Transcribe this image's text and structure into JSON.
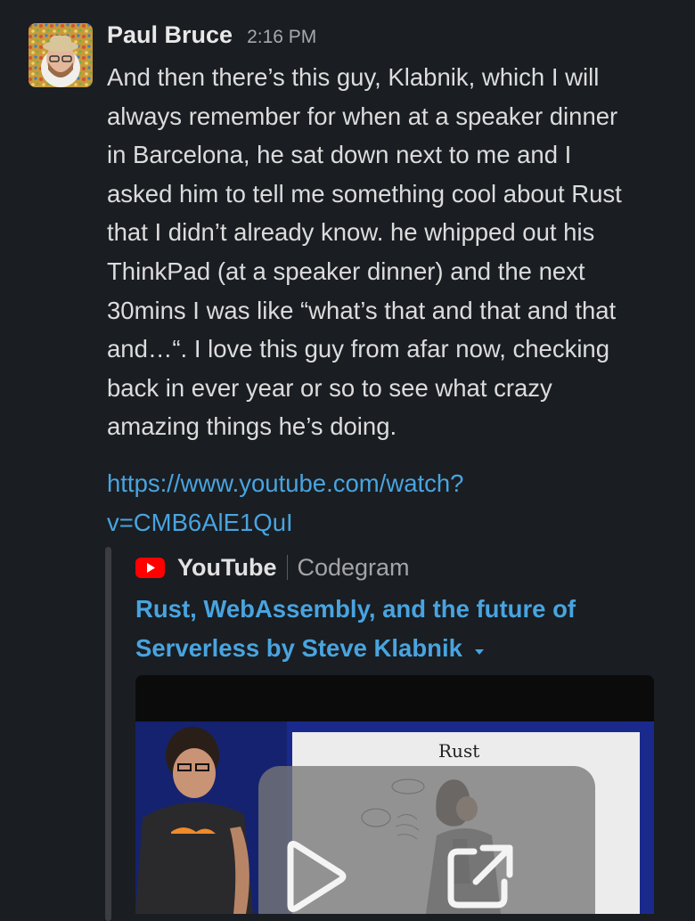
{
  "message": {
    "author": "Paul Bruce",
    "timestamp": "2:16 PM",
    "body": "And then there’s this guy, Klabnik, which I will\nalways remember for when at a speaker dinner\nin Barcelona, he sat down next to me and I\nasked him to tell me something cool about Rust\nthat I didn’t already know. he whipped out his\nThinkPad (at a speaker dinner) and the next\n30mins I was like “what’s that and that and that\nand…“. I love this guy from afar now, checking\nback in ever year or so to see what crazy\namazing things he’s doing.",
    "link_text": "https://www.youtube.com/watch?\nv=CMB6AlE1QuI"
  },
  "unfurl": {
    "service": "YouTube",
    "channel": "Codegram",
    "title": "Rust, WebAssembly, and the future of\nServerless by Steve Klabnik",
    "thumbnail_slide_text": "Rust",
    "icons": [
      "youtube-logo-icon",
      "caret-down-icon",
      "play-icon",
      "open-external-icon"
    ]
  },
  "colors": {
    "background": "#1a1d21",
    "link": "#48a4e0",
    "youtube_red": "#ff0000"
  }
}
